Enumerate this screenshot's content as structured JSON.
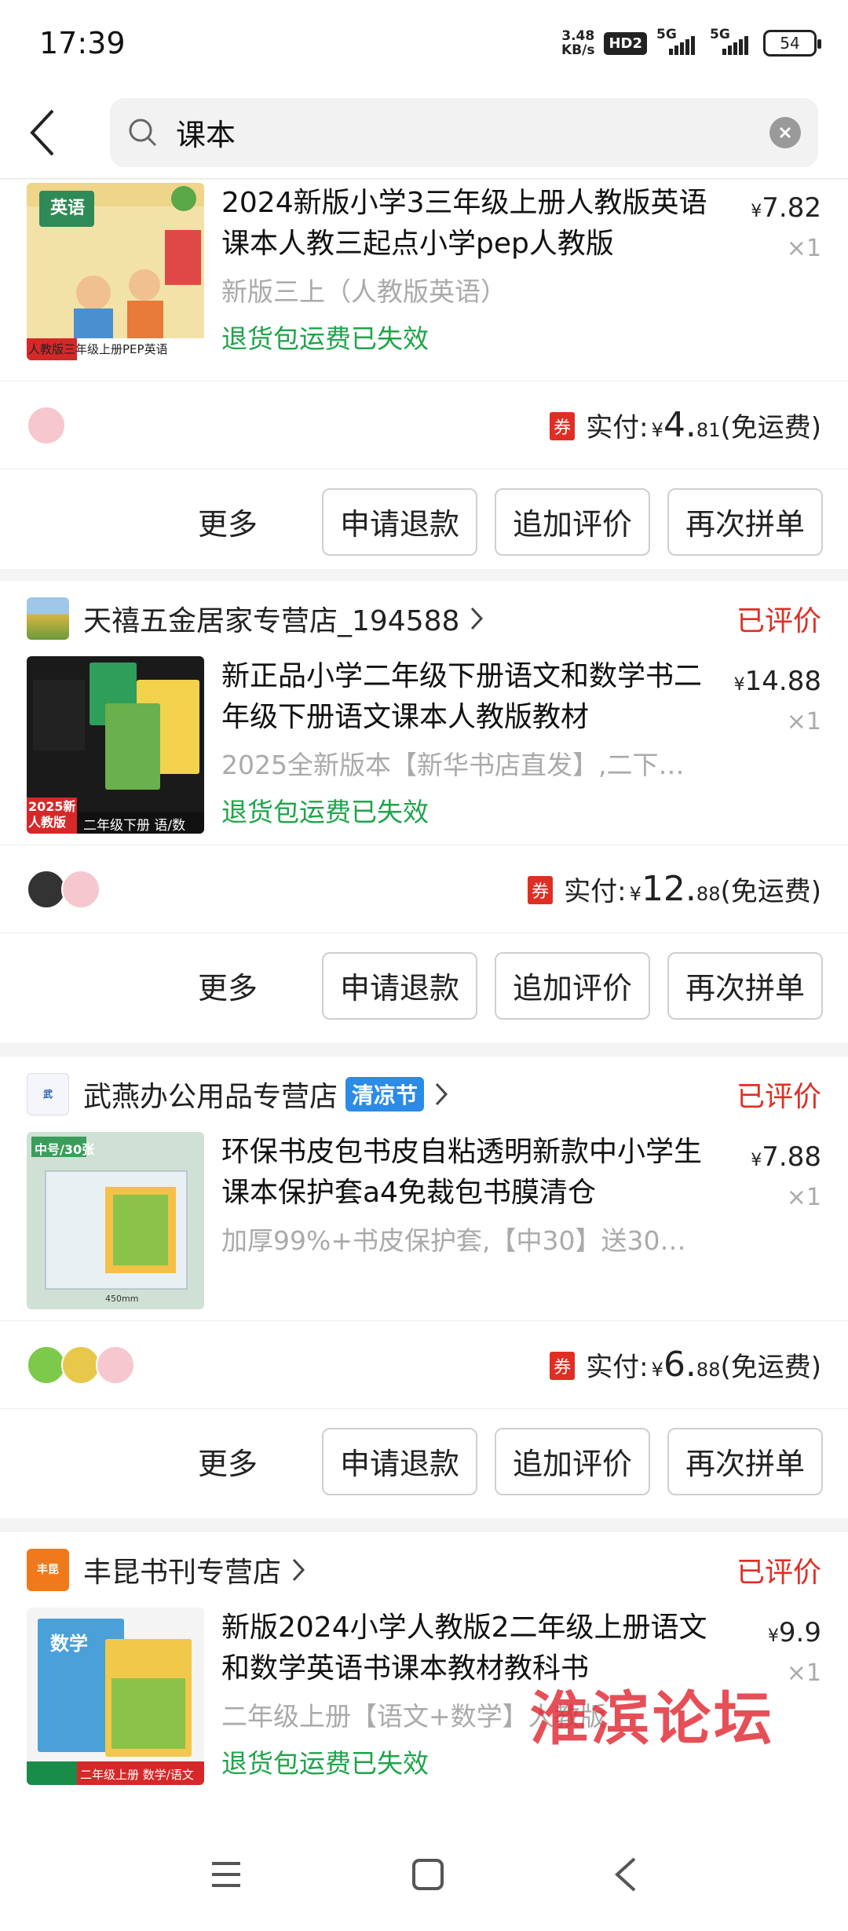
{
  "status_bar": {
    "time": "17:39",
    "net_speed_top": "3.48",
    "net_speed_bottom": "KB/s",
    "hd_badge": "HD2",
    "signal1": "5G",
    "signal2": "5G",
    "battery": "54"
  },
  "search": {
    "query": "课本"
  },
  "orders": [
    {
      "product_title": "2024新版小学3三年级上册人教版英语课本人教三起点小学pep人教版",
      "product_spec": "新版三上（人教版英语）",
      "return_note": "退货包运费已失效",
      "price_symbol": "¥",
      "price_int": "7.",
      "price_dec": "82",
      "qty": "×1",
      "thumb_label_top": "英语",
      "thumb_label_bottom": "人教版三年级上册PEP英语",
      "coupon": "券",
      "pay_label": "实付:",
      "pay_symbol": "¥",
      "pay_int": "4.",
      "pay_dec": "81",
      "shipping": "(免运费)",
      "more": "更多",
      "btn_refund": "申请退款",
      "btn_review": "追加评价",
      "btn_reorder": "再次拼单"
    },
    {
      "shop_name": "天禧五金居家专营店_194588",
      "review_status": "已评价",
      "product_title": "新正品小学二年级下册语文和数学书二年级下册语文课本人教版教材",
      "product_spec": "2025全新版本【新华书店直发】,二下…",
      "return_note": "退货包运费已失效",
      "price_symbol": "¥",
      "price_int": "14.",
      "price_dec": "88",
      "qty": "×1",
      "thumb_label_top": "2025新 人教版",
      "thumb_label_bottom": "二年级下册 语/数",
      "coupon": "券",
      "pay_label": "实付:",
      "pay_symbol": "¥",
      "pay_int": "12.",
      "pay_dec": "88",
      "shipping": "(免运费)",
      "more": "更多",
      "btn_refund": "申请退款",
      "btn_review": "追加评价",
      "btn_reorder": "再次拼单"
    },
    {
      "shop_name": "武燕办公用品专营店",
      "shop_tag": "清凉节",
      "review_status": "已评价",
      "product_title": "环保书皮包书皮自粘透明新款中小学生课本保护套a4免裁包书膜清仓",
      "product_spec": "加厚99%+书皮保护套,【中30】送30…",
      "price_symbol": "¥",
      "price_int": "7.",
      "price_dec": "88",
      "qty": "×1",
      "thumb_label_top": "中号/30张",
      "thumb_label_bottom": "450mm",
      "coupon": "券",
      "pay_label": "实付:",
      "pay_symbol": "¥",
      "pay_int": "6.",
      "pay_dec": "88",
      "shipping": "(免运费)",
      "more": "更多",
      "btn_refund": "申请退款",
      "btn_review": "追加评价",
      "btn_reorder": "再次拼单"
    },
    {
      "shop_name": "丰昆书刊专营店",
      "shop_logo": "丰昆",
      "review_status": "已评价",
      "product_title": "新版2024小学人教版2二年级上册语文和数学英语书课本教材教科书",
      "product_spec": "二年级上册【语文+数学】人教版",
      "return_note": "退货包运费已失效",
      "price_symbol": "¥",
      "price_int": "9.",
      "price_dec": "9",
      "qty": "×1",
      "thumb_label_top": "数学",
      "thumb_label_bottom": "二年级上册 数学/语文"
    }
  ],
  "watermark": "淮滨论坛",
  "colors": {
    "accent_red": "#e02e24",
    "return_green": "#1fa44a",
    "tag_blue": "#2b8be6"
  }
}
